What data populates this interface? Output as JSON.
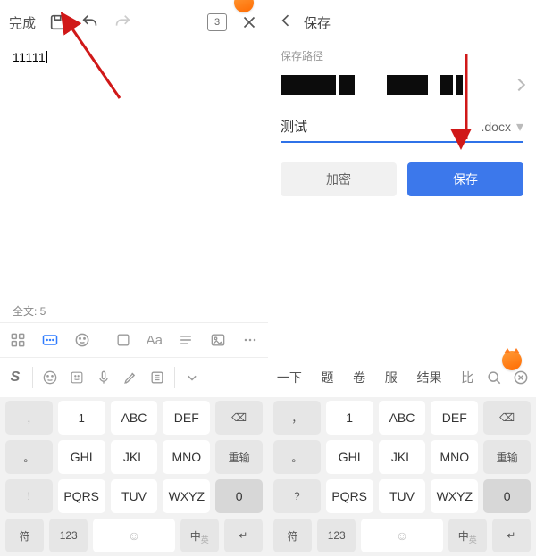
{
  "left": {
    "done": "完成",
    "page_badge": "3",
    "doc_text": "11111",
    "wander": "1",
    "word_count": "全文: 5",
    "toolbar_Aa": "Aa"
  },
  "right": {
    "title": "保存",
    "path_label": "保存路径",
    "filename": "测试",
    "extension": ".docx",
    "encrypt_btn": "加密",
    "save_btn": "保存"
  },
  "left_suggest": {
    "logo": "S"
  },
  "right_suggest": {
    "items": [
      "一下",
      "题",
      "卷",
      "服",
      "结果"
    ],
    "binbin": "比"
  },
  "keys": {
    "r1": [
      ",",
      "1",
      "ABC",
      "DEF"
    ],
    "del": "⌫",
    "r2": [
      "。",
      "GHI",
      "JKL",
      "MNO"
    ],
    "reenter": "重输",
    "r3": [
      "!",
      "PQRS",
      "TUV",
      "WXYZ"
    ],
    "zero": "0",
    "r4": {
      "sym": "符",
      "num": "123",
      "emoji": "☺",
      "lang": "中",
      "langsub": "英",
      "enter": "↵"
    }
  },
  "keys_r": {
    "r1": [
      "，",
      "1",
      "ABC",
      "DEF"
    ],
    "r2": [
      "。",
      "GHI",
      "JKL",
      "MNO"
    ],
    "r3": [
      "?",
      "PQRS",
      "TUV",
      "WXYZ"
    ]
  }
}
